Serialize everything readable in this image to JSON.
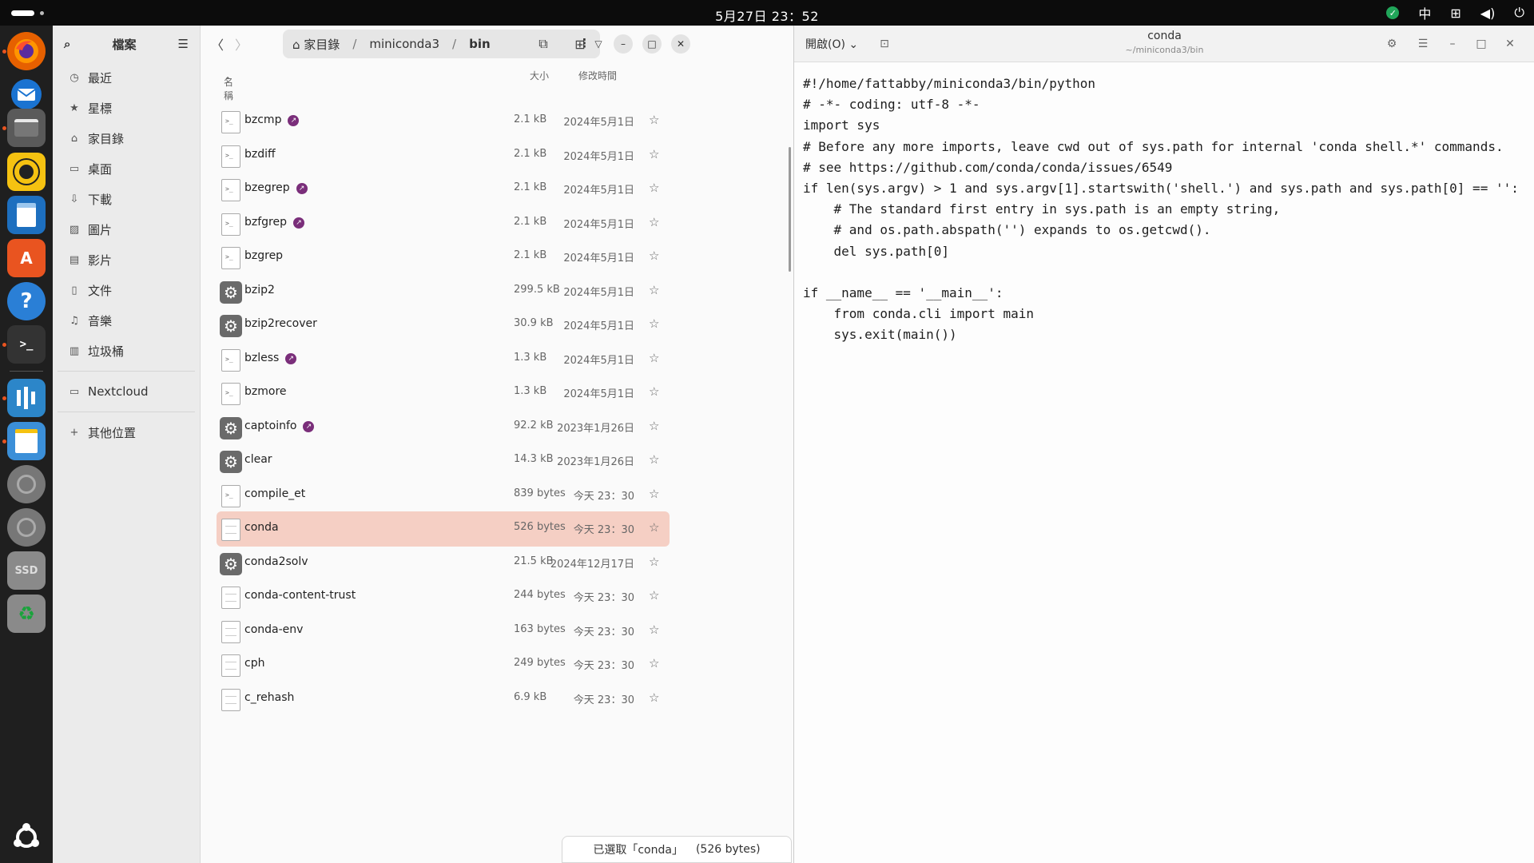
{
  "topbar": {
    "clock": "5月27日 23：52",
    "input_method": "中"
  },
  "dock": {
    "apps": [
      {
        "name": "firefox",
        "color": "#e66000"
      },
      {
        "name": "thunderbird",
        "color": "#1a73d1"
      },
      {
        "name": "files",
        "color": "#5a5a5a"
      },
      {
        "name": "rhythmbox",
        "color": "#f5c211"
      },
      {
        "name": "writer",
        "color": "#1d6fbf"
      },
      {
        "name": "app-center",
        "color": "#e95420"
      },
      {
        "name": "help",
        "color": "#2a7fd6"
      },
      {
        "name": "terminal",
        "color": "#333333"
      },
      {
        "name": "app-blue",
        "color": "#2c86c9"
      },
      {
        "name": "text-editor",
        "color": "#3b8fd8"
      },
      {
        "name": "disk-1",
        "color": "#777777"
      },
      {
        "name": "disk-2",
        "color": "#777777"
      },
      {
        "name": "ssd",
        "color": "#8a8a8a"
      },
      {
        "name": "trash",
        "color": "#8a8a8a"
      }
    ],
    "ssd_label": "SSD"
  },
  "files": {
    "sidebar": {
      "title": "檔案",
      "items": [
        {
          "label": "最近",
          "icon": "clock-icon",
          "glyph": "◷"
        },
        {
          "label": "星標",
          "icon": "star-icon",
          "glyph": "★"
        },
        {
          "label": "家目錄",
          "icon": "home-icon",
          "glyph": "⌂"
        },
        {
          "label": "桌面",
          "icon": "desktop-icon",
          "glyph": "▭"
        },
        {
          "label": "下載",
          "icon": "download-icon",
          "glyph": "⇩"
        },
        {
          "label": "圖片",
          "icon": "image-icon",
          "glyph": "▨"
        },
        {
          "label": "影片",
          "icon": "video-icon",
          "glyph": "▤"
        },
        {
          "label": "文件",
          "icon": "document-icon",
          "glyph": "▯"
        },
        {
          "label": "音樂",
          "icon": "music-icon",
          "glyph": "♫"
        },
        {
          "label": "垃圾桶",
          "icon": "trash-icon",
          "glyph": "▥"
        }
      ],
      "nextcloud": "Nextcloud",
      "other": "其他位置"
    },
    "path": {
      "home": "家目錄",
      "seg1": "miniconda3",
      "current": "bin"
    },
    "columns": {
      "name": "名稱",
      "size": "大小",
      "modified": "修改時間"
    },
    "rows": [
      {
        "name": "bzcmp",
        "size": "2.1 kB",
        "date": "2024年5月1日",
        "type": "script",
        "link": true,
        "selected": false
      },
      {
        "name": "bzdiff",
        "size": "2.1 kB",
        "date": "2024年5月1日",
        "type": "script",
        "link": false,
        "selected": false
      },
      {
        "name": "bzegrep",
        "size": "2.1 kB",
        "date": "2024年5月1日",
        "type": "script",
        "link": true,
        "selected": false
      },
      {
        "name": "bzfgrep",
        "size": "2.1 kB",
        "date": "2024年5月1日",
        "type": "script",
        "link": true,
        "selected": false
      },
      {
        "name": "bzgrep",
        "size": "2.1 kB",
        "date": "2024年5月1日",
        "type": "script",
        "link": false,
        "selected": false
      },
      {
        "name": "bzip2",
        "size": "299.5 kB",
        "date": "2024年5月1日",
        "type": "binary",
        "link": false,
        "selected": false
      },
      {
        "name": "bzip2recover",
        "size": "30.9 kB",
        "date": "2024年5月1日",
        "type": "binary",
        "link": false,
        "selected": false
      },
      {
        "name": "bzless",
        "size": "1.3 kB",
        "date": "2024年5月1日",
        "type": "script",
        "link": true,
        "selected": false
      },
      {
        "name": "bzmore",
        "size": "1.3 kB",
        "date": "2024年5月1日",
        "type": "script",
        "link": false,
        "selected": false
      },
      {
        "name": "captoinfo",
        "size": "92.2 kB",
        "date": "2023年1月26日",
        "type": "binary",
        "link": true,
        "selected": false
      },
      {
        "name": "clear",
        "size": "14.3 kB",
        "date": "2023年1月26日",
        "type": "binary",
        "link": false,
        "selected": false
      },
      {
        "name": "compile_et",
        "size": "839 bytes",
        "date": "今天 23：30",
        "type": "script",
        "link": false,
        "selected": false
      },
      {
        "name": "conda",
        "size": "526 bytes",
        "date": "今天 23：30",
        "type": "text",
        "link": false,
        "selected": true
      },
      {
        "name": "conda2solv",
        "size": "21.5 kB",
        "date": "2024年12月17日",
        "type": "binary",
        "link": false,
        "selected": false
      },
      {
        "name": "conda-content-trust",
        "size": "244 bytes",
        "date": "今天 23：30",
        "type": "text",
        "link": false,
        "selected": false
      },
      {
        "name": "conda-env",
        "size": "163 bytes",
        "date": "今天 23：30",
        "type": "text",
        "link": false,
        "selected": false
      },
      {
        "name": "cph",
        "size": "249 bytes",
        "date": "今天 23：30",
        "type": "text",
        "link": false,
        "selected": false
      },
      {
        "name": "c_rehash",
        "size": "6.9 kB",
        "date": "今天 23：30",
        "type": "text",
        "link": false,
        "selected": false
      }
    ],
    "status": {
      "selected": "已選取「conda」",
      "size": "(526 bytes)"
    }
  },
  "editor": {
    "open_menu": "開啟(O)",
    "title": "conda",
    "subtitle": "~/miniconda3/bin",
    "code": "#!/home/fattabby/miniconda3/bin/python\n# -*- coding: utf-8 -*-\nimport sys\n# Before any more imports, leave cwd out of sys.path for internal 'conda shell.*' commands.\n# see https://github.com/conda/conda/issues/6549\nif len(sys.argv) > 1 and sys.argv[1].startswith('shell.') and sys.path and sys.path[0] == '':\n    # The standard first entry in sys.path is an empty string,\n    # and os.path.abspath('') expands to os.getcwd().\n    del sys.path[0]\n\nif __name__ == '__main__':\n    from conda.cli import main\n    sys.exit(main())"
  }
}
